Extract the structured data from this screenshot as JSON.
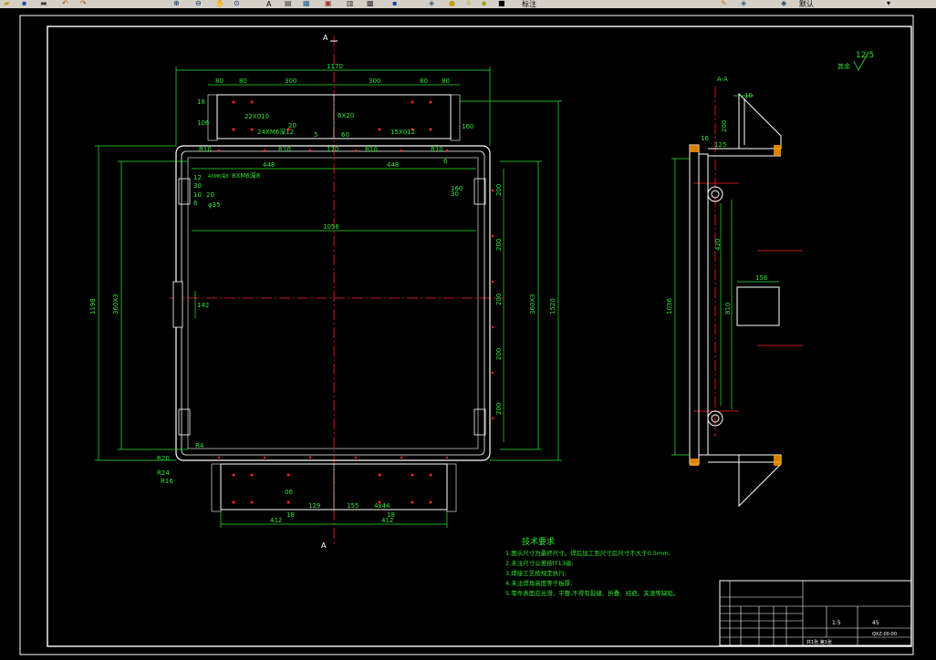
{
  "toolbar": {
    "icons": [
      "open-icon",
      "save-icon",
      "print-icon",
      "undo-icon",
      "redo-icon",
      "zoom-in-icon",
      "zoom-out-icon",
      "pan-icon",
      "text-style-icon",
      "properties-icon",
      "layer-icon",
      "calculator-icon"
    ],
    "text_style_label": "A",
    "style_dropdown_value": "标注",
    "layer_dropdown_value": "默认"
  },
  "drawing": {
    "front_view": {
      "section_mark": "A",
      "overall_width": "1170",
      "top_dims": [
        "80",
        "80",
        "300",
        "300",
        "80",
        "80"
      ],
      "left_dims": [
        "18",
        "106"
      ],
      "right_dim_top": "160",
      "hole_notes": [
        "22X010",
        "6X20",
        "24XM6深12",
        "15X012"
      ],
      "dim_20": "20",
      "dim_5": "5",
      "dim_60_top": "60",
      "small_dims": [
        "R10",
        "R10",
        "R10",
        "R10"
      ],
      "dim_170": "170",
      "half_widths": [
        "448",
        "448"
      ],
      "dim_6": "6",
      "left_notes": [
        "12",
        "4XM6深8",
        "8XM6深8",
        "30",
        "10",
        "6",
        "20",
        "φ35"
      ],
      "inner_width": "1056",
      "height_label": "1198",
      "spacing_label_left": "360X3",
      "center_dim": "142",
      "right_dims": [
        "200",
        "200",
        "200",
        "200",
        "200"
      ],
      "dim_30": "30",
      "dim_160_right": "160",
      "spacing_label_right": "360X3",
      "total_height": "1520",
      "radii": [
        "R4",
        "R20",
        "R24",
        "R16"
      ],
      "bottom_dims": [
        "06",
        "129",
        "155",
        "4x44",
        "18",
        "18"
      ],
      "bottom_halves": [
        "412",
        "412"
      ],
      "bottom_section_mark": "A"
    },
    "side_view": {
      "section_label": "A-A",
      "dim_10": "10",
      "dim_200": "200",
      "dim_16": "16",
      "dim_12": "12",
      "dim_5": "5",
      "height": "1036",
      "dim_420": "420",
      "dim_156": "156",
      "dim_810": "810"
    },
    "roughness": {
      "label": "其余",
      "value": "12.5"
    },
    "notes": {
      "title": "技术要求",
      "items": [
        "1.图示尺寸为最终尺寸。焊后加工到尺寸后尺寸不大于0.5mm;",
        "2.未注尺寸公差按IT13级;",
        "3.焊接工艺按规定执行;",
        "4.未注焊角高度等于板厚;",
        "5.零件表面应光滑、平整,不得有裂缝、折叠、结疤、夹渣等缺陷。"
      ]
    },
    "title_block": {
      "material": "45",
      "ratio": "1:5",
      "drawing_no": "QXZ-00-00",
      "sheet_info": "共1张 第1张"
    }
  }
}
